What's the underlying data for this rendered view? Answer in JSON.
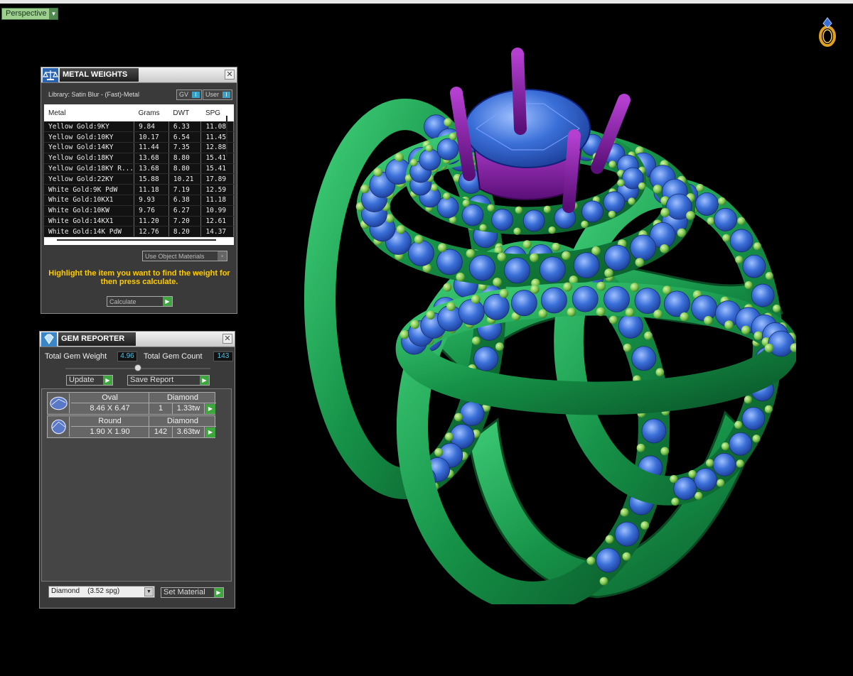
{
  "viewport": {
    "view_mode": "Perspective"
  },
  "metal_weights": {
    "title": "METAL WEIGHTS",
    "library": "Library: Satin Blur - (Fast)-Metal",
    "toggle_gv": "GV",
    "toggle_user": "User",
    "columns": [
      "Metal",
      "Grams",
      "DWT",
      "SPG"
    ],
    "rows": [
      [
        "Yellow Gold:9KY",
        "9.84",
        "6.33",
        "11.08"
      ],
      [
        "Yellow Gold:10KY",
        "10.17",
        "6.54",
        "11.45"
      ],
      [
        "Yellow Gold:14KY",
        "11.44",
        "7.35",
        "12.88"
      ],
      [
        "Yellow Gold:18KY",
        "13.68",
        "8.80",
        "15.41"
      ],
      [
        "Yellow Gold:18KY R...",
        "13.68",
        "8.80",
        "15.41"
      ],
      [
        "Yellow Gold:22KY",
        "15.88",
        "10.21",
        "17.89"
      ],
      [
        "White Gold:9K PdW",
        "11.18",
        "7.19",
        "12.59"
      ],
      [
        "White Gold:10KX1",
        "9.93",
        "6.38",
        "11.18"
      ],
      [
        "White Gold:10KW",
        "9.76",
        "6.27",
        "10.99"
      ],
      [
        "White Gold:14KX1",
        "11.20",
        "7.20",
        "12.61"
      ],
      [
        "White Gold:14K PdW",
        "12.76",
        "8.20",
        "14.37"
      ]
    ],
    "use_object_materials": "Use Object Materials",
    "hint": "Highlight the item you want to find the weight for then press calculate.",
    "calculate": "Calculate"
  },
  "gem_reporter": {
    "title": "GEM REPORTER",
    "total_weight_label": "Total Gem Weight",
    "total_weight": "4.96",
    "total_count_label": "Total Gem Count",
    "total_count": "143",
    "update": "Update",
    "save_report": "Save Report",
    "gems": [
      {
        "shape": "Oval",
        "type": "Diamond",
        "size": "8.46 X 6.47",
        "qty": "1",
        "weight": "1.33tw"
      },
      {
        "shape": "Round",
        "type": "Diamond",
        "size": "1.90 X 1.90",
        "qty": "142",
        "weight": "3.63tw"
      }
    ],
    "material_select": "Diamond    (3.52 spg)",
    "set_material": "Set Material"
  },
  "colors": {
    "metal": "#1e9a4e",
    "prongs": "#7ec850",
    "gems": "#3a6fd8",
    "center_stone": "#2545d0",
    "head": "#8a1fa6"
  }
}
